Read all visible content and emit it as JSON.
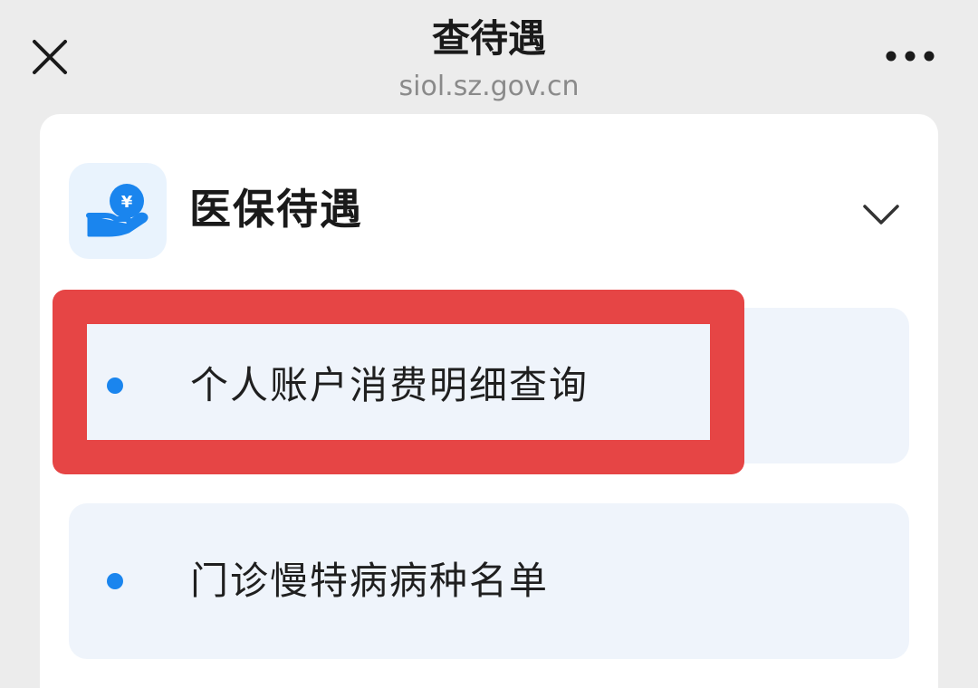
{
  "navbar": {
    "close_icon": "close-icon",
    "title": "查待遇",
    "url": "siol.sz.gov.cn",
    "more_icon": "more-icon"
  },
  "section": {
    "icon": "hand-yen-coin-icon",
    "icon_glyph": "¥",
    "title": "医保待遇",
    "expand_icon": "chevron-down-icon",
    "items": [
      {
        "label": "个人账户消费明细查询",
        "highlighted": true
      },
      {
        "label": "门诊慢特病病种名单",
        "highlighted": false
      }
    ]
  },
  "colors": {
    "accent": "#1a85ee",
    "highlight": "#e64545",
    "item_background": "#eff4fb",
    "icon_background": "#e9f3fd"
  }
}
